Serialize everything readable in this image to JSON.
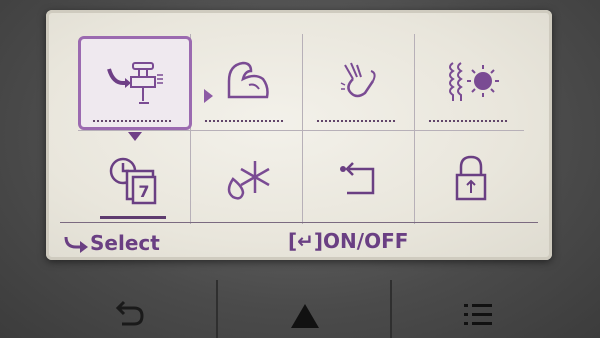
{
  "screen": {
    "menu_icons": [
      {
        "name": "hot-water-icon",
        "selected": true
      },
      {
        "name": "muscle-icon"
      },
      {
        "name": "hand-wash-icon"
      },
      {
        "name": "heater-sun-icon"
      },
      {
        "name": "weekly-calendar-icon"
      },
      {
        "name": "snowflake-drop-icon"
      },
      {
        "name": "return-arrow-icon"
      },
      {
        "name": "lock-icon"
      }
    ],
    "calendar_day": "7",
    "status_bar": {
      "select_label": "Select",
      "onoff_label": "ON/OFF",
      "onoff_prefix": "[↵]"
    }
  },
  "hardware_buttons": [
    {
      "name": "back-icon"
    },
    {
      "name": "up-triangle-icon"
    },
    {
      "name": "menu-list-icon"
    }
  ],
  "colors": {
    "accent": "#8d5aa5",
    "icon": "#7a4b93",
    "screen_bg": "#ece9e0"
  }
}
